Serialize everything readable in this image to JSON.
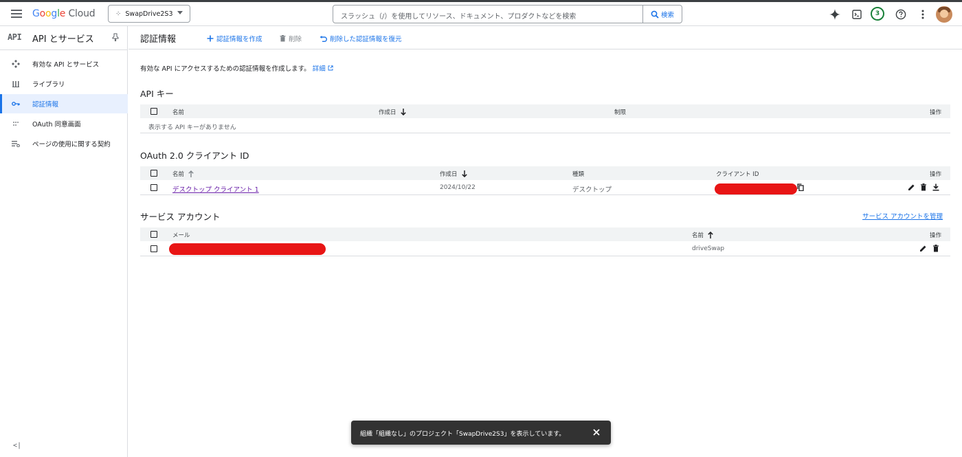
{
  "topbar": {
    "logo_text": "Google Cloud",
    "project_name": "SwapDrive2S3",
    "search_placeholder": "スラッシュ（/）を使用してリソース、ドキュメント、プロダクトなどを検索",
    "search_button": "検索",
    "notification_count": "3"
  },
  "sidebar": {
    "api_logo": "API",
    "title": "API とサービス",
    "items": [
      {
        "label": "有効な API とサービス",
        "icon": "api-hub-icon"
      },
      {
        "label": "ライブラリ",
        "icon": "library-icon"
      },
      {
        "label": "認証情報",
        "icon": "key-icon",
        "active": true
      },
      {
        "label": "OAuth 同意画面",
        "icon": "consent-icon"
      },
      {
        "label": "ページの使用に関する契約",
        "icon": "settings-list-icon"
      }
    ],
    "collapse": "<|"
  },
  "header": {
    "title": "認証情報",
    "create": "認証情報を作成",
    "delete": "削除",
    "restore": "削除した認証情報を復元"
  },
  "intro": {
    "text": "有効な API にアクセスするための認証情報を作成します。",
    "link": "詳細"
  },
  "api_keys": {
    "title": "API キー",
    "columns": [
      "名前",
      "作成日",
      "制限",
      "操作"
    ],
    "empty": "表示する API キーがありません"
  },
  "oauth": {
    "title": "OAuth 2.0 クライアント ID",
    "columns": [
      "名前",
      "作成日",
      "種類",
      "クライアント ID",
      "操作"
    ],
    "rows": [
      {
        "name": "デスクトップ クライアント 1",
        "date": "2024/10/22",
        "type": "デスクトップ"
      }
    ]
  },
  "service_accounts": {
    "title": "サービス アカウント",
    "manage_link": "サービス アカウントを管理",
    "columns": [
      "メール",
      "名前",
      "操作"
    ],
    "rows": [
      {
        "name": "driveSwap"
      }
    ]
  },
  "snackbar": {
    "message": "組織「組織なし」のプロジェクト「SwapDrive2S3」を表示しています。"
  },
  "colors": {
    "accent": "#1a73e8",
    "redaction": "#e81515"
  }
}
